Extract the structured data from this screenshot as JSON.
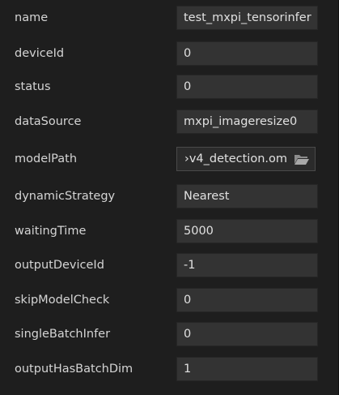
{
  "properties": [
    {
      "label": "name",
      "value": "test_mxpi_tensorinfer"
    },
    {
      "label": "deviceId",
      "value": "0"
    },
    {
      "label": "status",
      "value": "0"
    },
    {
      "label": "dataSource",
      "value": "mxpi_imageresize0"
    },
    {
      "label": "modelPath",
      "value": "›v4_detection.om"
    },
    {
      "label": "dynamicStrategy",
      "value": "Nearest"
    },
    {
      "label": "waitingTime",
      "value": "5000"
    },
    {
      "label": "outputDeviceId",
      "value": "-1"
    },
    {
      "label": "skipModelCheck",
      "value": "0"
    },
    {
      "label": "singleBatchInfer",
      "value": "0"
    },
    {
      "label": "outputHasBatchDim",
      "value": "1"
    }
  ],
  "icons": {
    "model_path_browse": "folder-open-icon"
  },
  "colors": {
    "background": "#1e1e1e",
    "field_background": "#333333",
    "text": "#d4d4d4"
  }
}
